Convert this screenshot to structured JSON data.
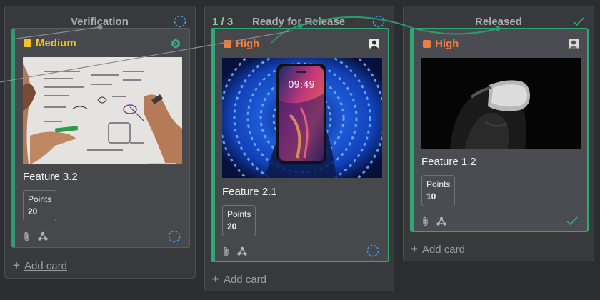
{
  "columns": [
    {
      "title": "Verification",
      "card": {
        "priority": "Medium",
        "priority_color": "#f5c518",
        "title": "Feature 3.2",
        "points_label": "Points",
        "points_value": "20"
      },
      "add_card": "Add card"
    },
    {
      "count": "1 / 3",
      "title": "Ready for Release",
      "card": {
        "priority": "High",
        "priority_color": "#f07e3f",
        "title": "Feature 2.1",
        "points_label": "Points",
        "points_value": "20",
        "phone_time": "09:49"
      },
      "add_card": "Add card"
    },
    {
      "title": "Released",
      "card": {
        "priority": "High",
        "priority_color": "#f07e3f",
        "title": "Feature 1.2",
        "points_label": "Points",
        "points_value": "10"
      },
      "add_card": "Add card"
    }
  ],
  "colors": {
    "accent": "#2fa874",
    "status_blue": "#3ba3e6",
    "connector": "#2f9a6d"
  },
  "icons": [
    "paperclip-icon",
    "share-nodes-icon",
    "loading-circle-icon",
    "checkmark-icon",
    "gear-icon",
    "avatar"
  ]
}
